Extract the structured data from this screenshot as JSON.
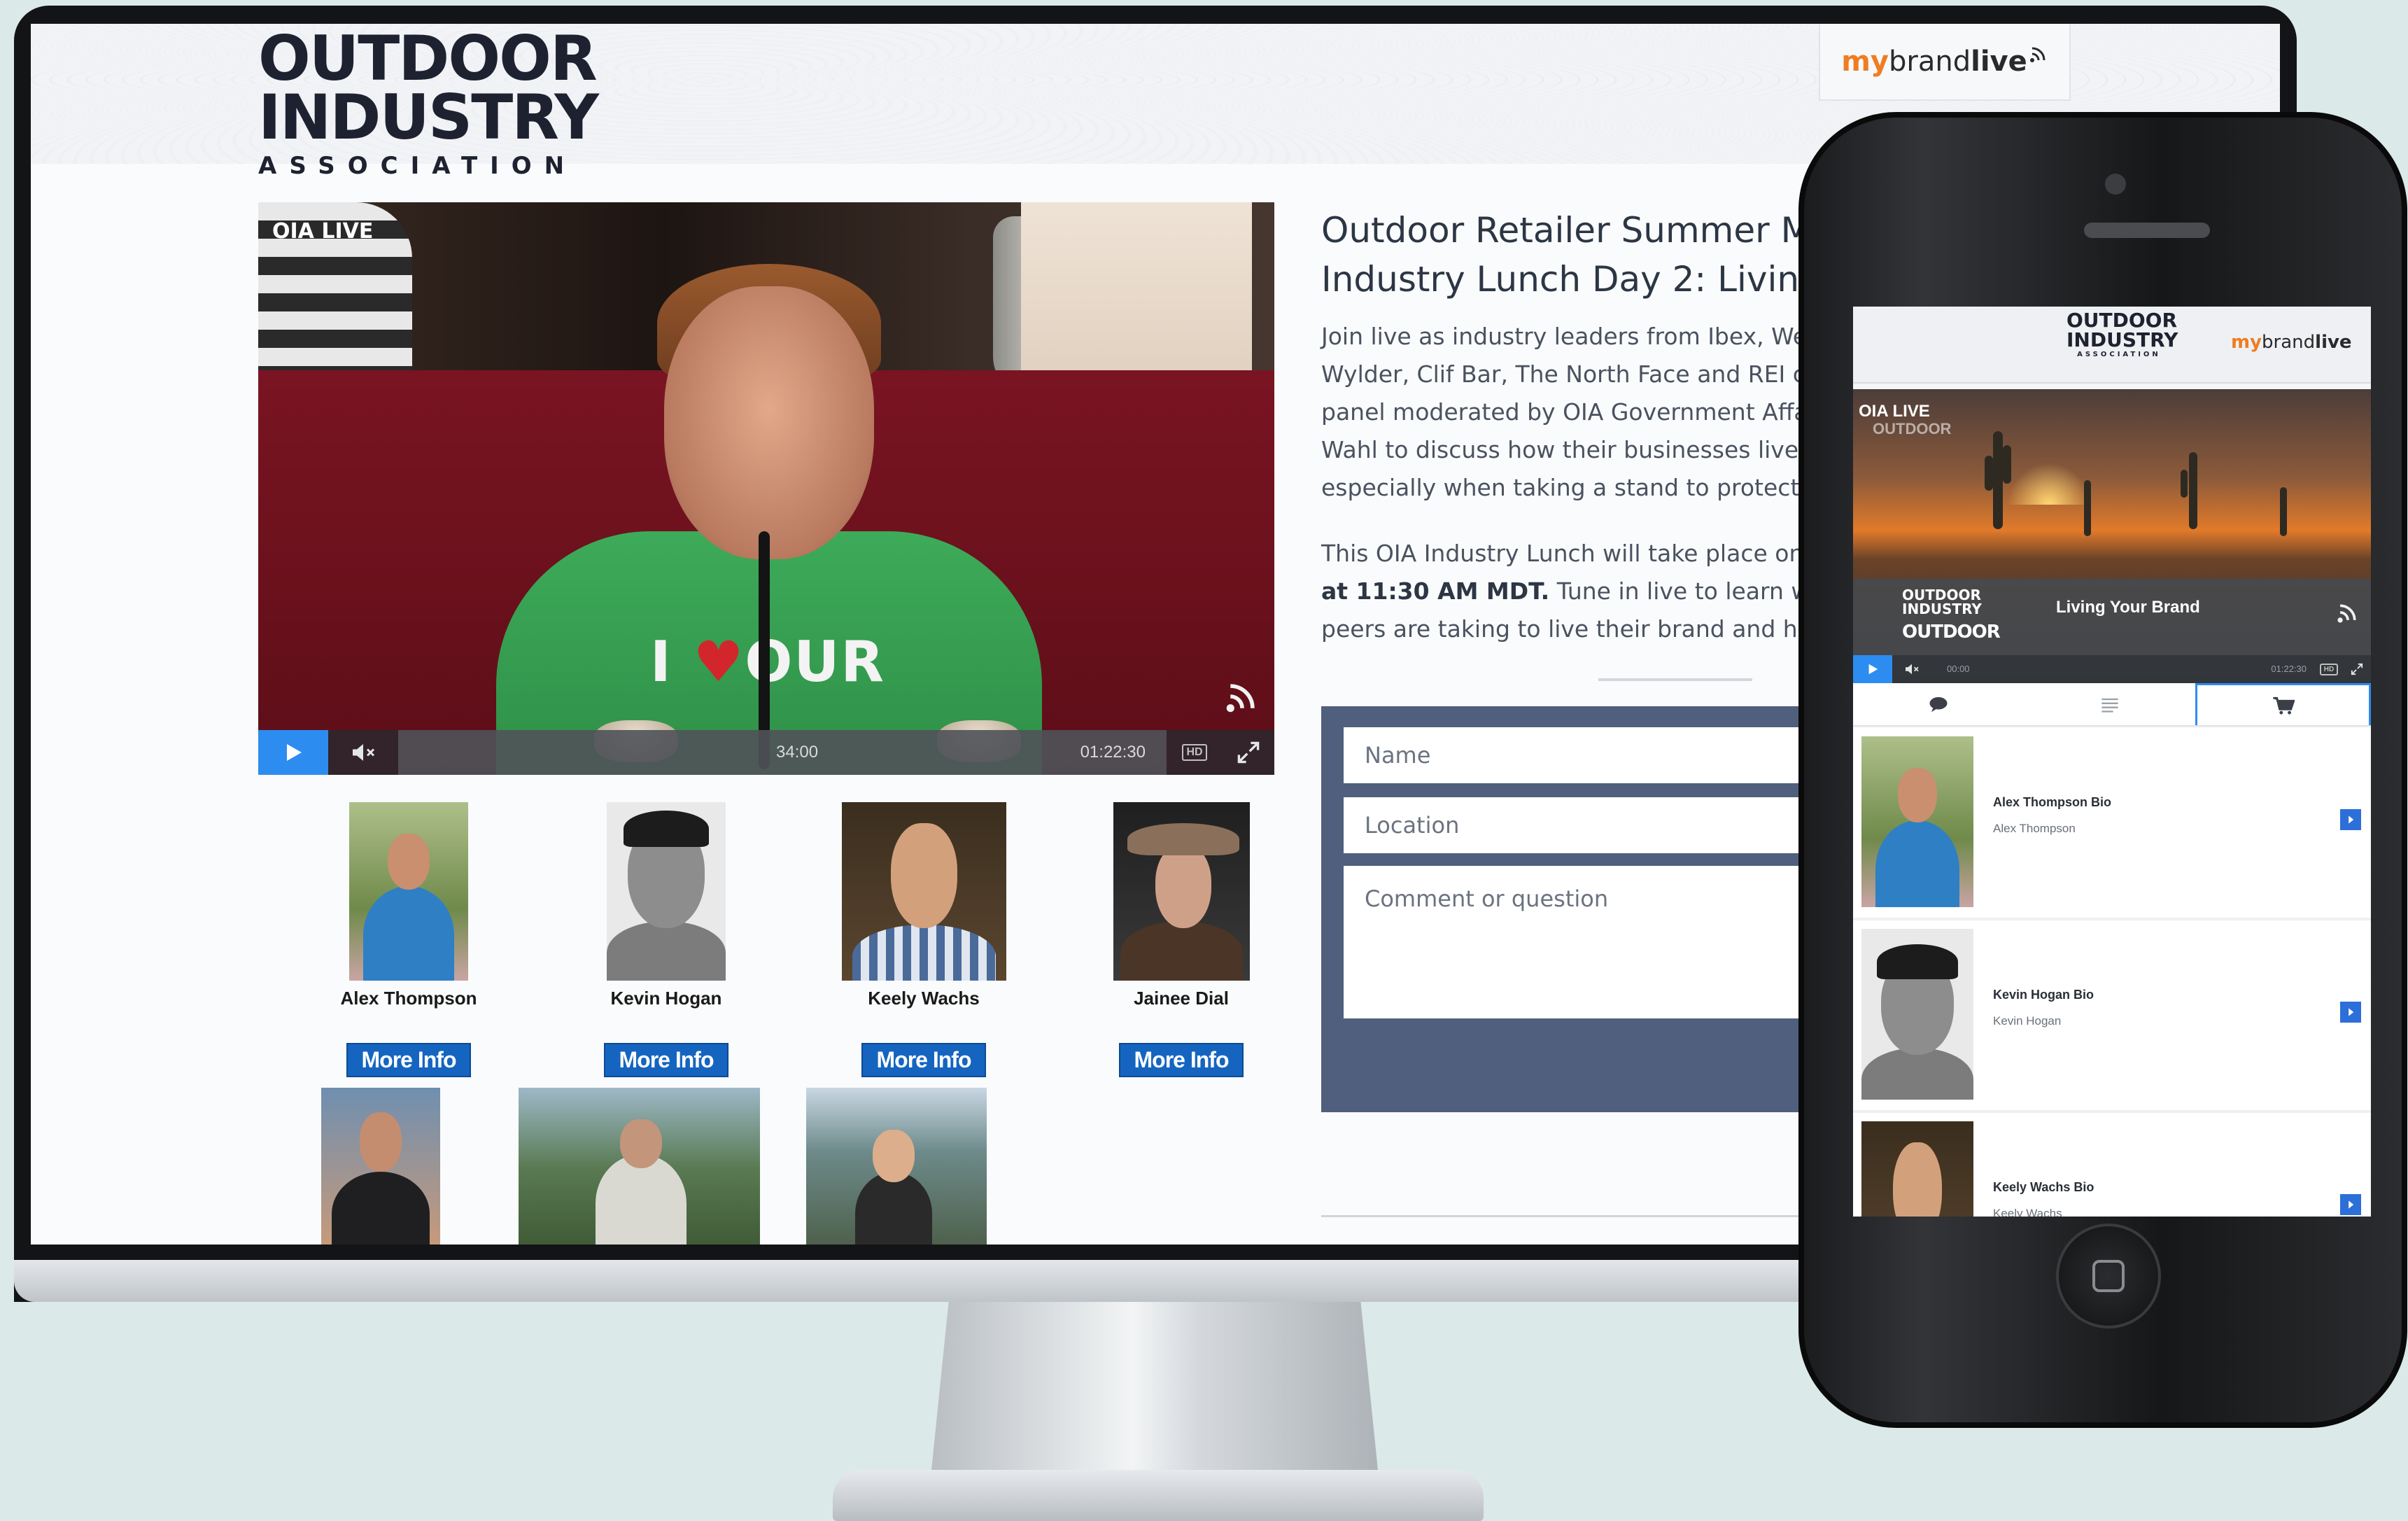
{
  "brand": {
    "org_logo_line1": "OUTDOOR",
    "org_logo_line2": "INDUSTRY",
    "org_logo_line3": "ASSOCIATION",
    "platform_logo_my": "my",
    "platform_logo_brand": "brand",
    "platform_logo_live": "live"
  },
  "video": {
    "badge": "OIA LIVE",
    "shirt_text_1": "I",
    "shirt_heart": "♥",
    "shirt_text_2": "OUR",
    "current_time": "34:00",
    "total_time": "01:22:30",
    "hd_label": "HD",
    "icons": [
      "play-icon",
      "mute-icon",
      "hd-icon",
      "fullscreen-icon",
      "cast-icon"
    ]
  },
  "event": {
    "title_line1": "Outdoor Retailer Summer Ma",
    "title_line2": "Industry Lunch Day 2: Living Y",
    "desc_p1": [
      "Join live as industry leaders from Ibex, We",
      "Wylder, Clif Bar, The North Face and REI co",
      "panel moderated by OIA Government Affai",
      "Wahl to discuss how their businesses live t",
      "especially when taking a stand to protect p"
    ],
    "desc_p2_line1": "This OIA Industry Lunch will take place on",
    "desc_p2_line2_bold": "at 11:30 AM MDT.",
    "desc_p2_line2_rest": " Tune in live to learn wha",
    "desc_p2_line3": "peers are taking to live their brand and how"
  },
  "form": {
    "name_placeholder": "Name",
    "location_placeholder": "Location",
    "comment_placeholder": "Comment or question"
  },
  "people": [
    {
      "name": "Alex Thompson",
      "button": "More Info"
    },
    {
      "name": "Kevin Hogan",
      "button": "More Info"
    },
    {
      "name": "Keely Wachs",
      "button": "More Info"
    },
    {
      "name": "Jainee Dial",
      "button": "More Info"
    }
  ],
  "phone": {
    "logo_line1": "OUTDOOR",
    "logo_line2": "INDUSTRY",
    "logo_line3": "ASSOCIATION",
    "video_badge": "OIA LIVE",
    "video_sub": "OUTDOOR",
    "lower_third_logo1": "OUTDOOR",
    "lower_third_logo2": "INDUSTRY",
    "lower_third_logo3": "OUTDOOR",
    "lower_third_title": "Living Your Brand",
    "current_time": "00:00",
    "total_time": "01:22:30",
    "hd_label": "HD",
    "tabs": [
      "chat-icon",
      "list-icon",
      "cart-icon"
    ],
    "active_tab": "cart-icon",
    "bios": [
      {
        "title": "Alex Thompson Bio",
        "subtitle": "Alex Thompson"
      },
      {
        "title": "Kevin Hogan Bio",
        "subtitle": "Kevin Hogan"
      },
      {
        "title": "Keely Wachs Bio",
        "subtitle": "Keely Wachs"
      }
    ]
  },
  "colors": {
    "accent_blue": "#2d8cf0",
    "button_blue": "#1565c0",
    "form_panel": "#4f5f7d",
    "brand_orange": "#ef7d22",
    "background": "#dbe9e8"
  }
}
